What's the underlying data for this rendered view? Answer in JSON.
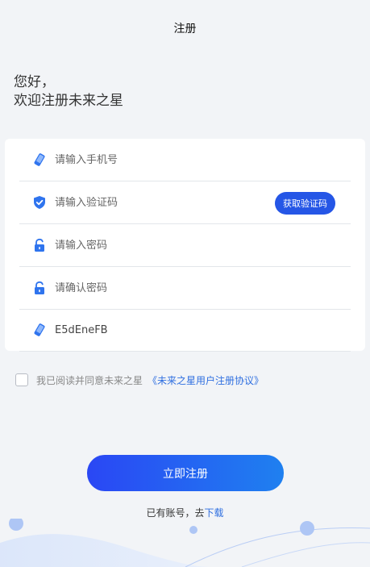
{
  "header": {
    "title": "注册"
  },
  "greeting": {
    "line1": "您好，",
    "line2": "欢迎注册未来之星"
  },
  "form": {
    "phone_placeholder": "请输入手机号",
    "code_placeholder": "请输入验证码",
    "get_code_label": "获取验证码",
    "password_placeholder": "请输入密码",
    "confirm_password_placeholder": "请确认密码",
    "invite_code_value": "E5dEneFB"
  },
  "agreement": {
    "text": "我已阅读并同意未来之星",
    "link_text": "《未来之星用户注册协议》"
  },
  "submit_label": "立即注册",
  "login": {
    "prefix": "已有账号，去",
    "link_text": "下载"
  },
  "colors": {
    "accent": "#2556e6",
    "link": "#2f6fe0",
    "background": "#f2f4f7"
  }
}
